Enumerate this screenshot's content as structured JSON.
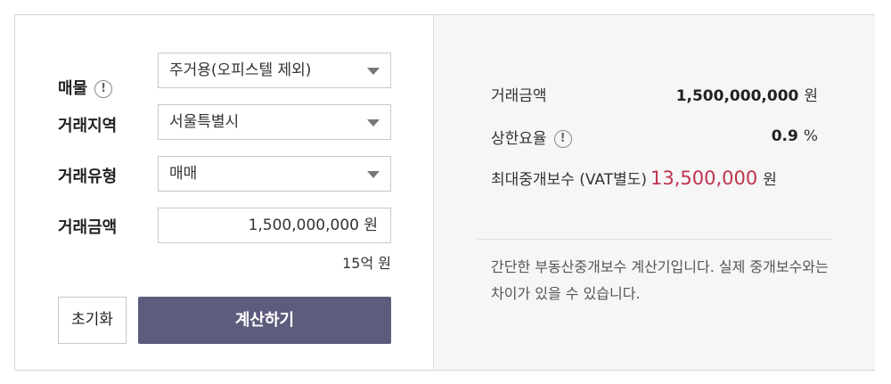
{
  "form": {
    "property_label": "매물",
    "property_value": "주거용(오피스텔 제외)",
    "region_label": "거래지역",
    "region_value": "서울특별시",
    "type_label": "거래유형",
    "type_value": "매매",
    "amount_label": "거래금액",
    "amount_value": "1,500,000,000",
    "amount_unit": "원",
    "amount_readable": "15억 원",
    "reset_label": "초기화",
    "calculate_label": "계산하기",
    "info_glyph": "!"
  },
  "result": {
    "amount_label": "거래금액",
    "amount_value": "1,500,000,000",
    "amount_unit": "원",
    "rate_label": "상한요율",
    "rate_value": "0.9",
    "rate_unit": "%",
    "fee_label": "최대중개보수 (VAT별도)",
    "fee_value": "13,500,000",
    "fee_unit": "원",
    "note": "간단한 부동산중개보수 계산기입니다. 실제 중개보수와는 차이가 있을 수 있습니다."
  },
  "colors": {
    "accent_button": "#5e5c7d",
    "fee_highlight": "#c0344c",
    "result_bg": "#f6f6f6"
  }
}
